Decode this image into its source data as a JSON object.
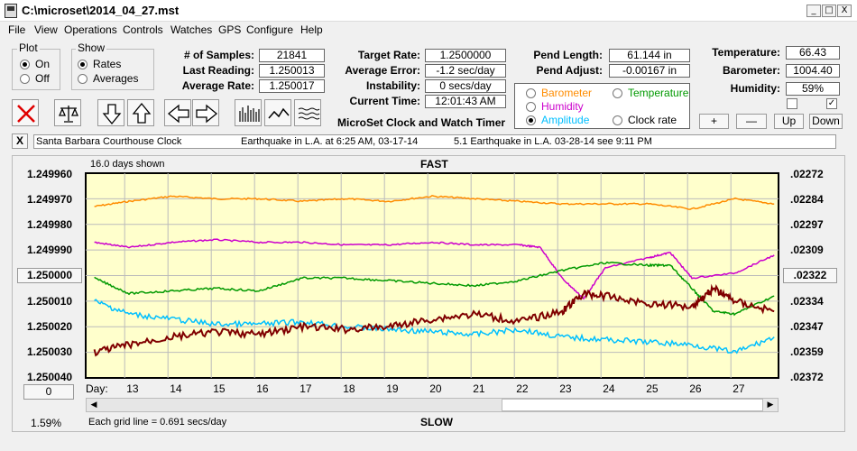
{
  "window": {
    "title": "C:\\microset\\2014_04_27.mst"
  },
  "window_controls": {
    "minimize": "_",
    "maximize": "□",
    "close": "X"
  },
  "menu": [
    "File",
    "View",
    "Operations",
    "Controls",
    "Watches",
    "GPS",
    "Configure",
    "Help"
  ],
  "plot_group": {
    "label": "Plot",
    "options": [
      "On",
      "Off"
    ],
    "selected": "On"
  },
  "show_group": {
    "label": "Show",
    "options": [
      "Rates",
      "Averages"
    ],
    "selected": "Rates"
  },
  "stats": {
    "samples_label": "# of Samples:",
    "samples": "21841",
    "last_reading_label": "Last Reading:",
    "last_reading": "1.250013",
    "average_rate_label": "Average Rate:",
    "average_rate": "1.250017",
    "target_rate_label": "Target Rate:",
    "target_rate": "1.2500000",
    "average_error_label": "Average Error:",
    "average_error": "-1.2 sec/day",
    "instability_label": "Instability:",
    "instability": "0 secs/day",
    "current_time_label": "Current Time:",
    "current_time": "12:01:43 AM",
    "pend_length_label": "Pend Length:",
    "pend_length": "61.144 in",
    "pend_adjust_label": "Pend Adjust:",
    "pend_adjust": "-0.00167 in",
    "temperature_label": "Temperature:",
    "temperature": "66.43",
    "barometer_label": "Barometer:",
    "barometer": "1004.40",
    "humidity_label": "Humidity:",
    "humidity": "59%"
  },
  "app_title": "MicroSet Clock and Watch Timer",
  "series_selector": {
    "items": [
      {
        "label": "Barometer",
        "color": "#ff8c00",
        "selected": false
      },
      {
        "label": "Temperature",
        "color": "#009900",
        "selected": false
      },
      {
        "label": "Humidity",
        "color": "#cc00cc",
        "selected": false
      },
      {
        "label": "Amplitude",
        "color": "#00bfff",
        "selected": true
      },
      {
        "label": "Clock rate",
        "color": "#000000",
        "selected": false
      }
    ]
  },
  "adjust_buttons": {
    "plus": "+",
    "minus": "—",
    "up": "Up",
    "down": "Down"
  },
  "checkboxes": [
    false,
    true
  ],
  "notes": {
    "close": "X",
    "clock_name": "Santa Barbara Courthouse Clock",
    "note1": "Earthquake in L.A. at 6:25 AM, 03-17-14",
    "note2": "5.1 Earthquake in L.A. 03-28-14  see 9:11 PM"
  },
  "chart_data": {
    "type": "line",
    "title": "FAST",
    "bottom_title": "SLOW",
    "days_shown": "16.0 days shown",
    "grid_note": "Each grid line = 0.691 secs/day",
    "left_percent": "1.59%",
    "x_prefix": "Day:",
    "x_ticks": [
      "13",
      "14",
      "15",
      "16",
      "17",
      "18",
      "19",
      "20",
      "21",
      "22",
      "23",
      "24",
      "25",
      "26",
      "27"
    ],
    "y_left_ticks": [
      "1.249960",
      "1.249970",
      "1.249980",
      "1.249990",
      "1.250000",
      "1.250010",
      "1.250020",
      "1.250030",
      "1.250040"
    ],
    "y_right_ticks": [
      ".02272",
      ".02284",
      ".02297",
      ".02309",
      ".02322",
      ".02334",
      ".02347",
      ".02359",
      ".02372"
    ],
    "y_center_button": "1.250000",
    "y_right_center_button": ".02322",
    "bottom_left_button": "0",
    "ylim_rate": [
      1.24996,
      1.25004
    ],
    "grid": true,
    "series": [
      {
        "name": "Barometer",
        "color": "#ff8c00",
        "x": [
          12.2,
          13,
          14,
          15,
          16,
          17,
          18,
          19,
          20,
          21,
          22,
          23,
          24,
          25,
          26,
          27,
          27.9
        ],
        "y": [
          1.249973,
          1.249971,
          1.249969,
          1.24997,
          1.24997,
          1.249971,
          1.24997,
          1.249971,
          1.249969,
          1.24997,
          1.249971,
          1.249972,
          1.249972,
          1.249972,
          1.249974,
          1.24997,
          1.249972
        ]
      },
      {
        "name": "Humidity",
        "color": "#cc00cc",
        "x": [
          12.2,
          13,
          14,
          15,
          16,
          17,
          18,
          19,
          20,
          21,
          22,
          22.5,
          23,
          23.5,
          24,
          25,
          25.5,
          26,
          27,
          27.9
        ],
        "y": [
          1.249987,
          1.249989,
          1.249987,
          1.249986,
          1.249987,
          1.249987,
          1.249988,
          1.249988,
          1.249987,
          1.249988,
          1.249988,
          1.249989,
          1.250001,
          1.250009,
          1.249997,
          1.249993,
          1.249991,
          1.250001,
          1.249999,
          1.249992
        ]
      },
      {
        "name": "Temperature",
        "color": "#009900",
        "x": [
          12.2,
          13,
          14,
          15,
          16,
          17,
          18,
          19,
          20,
          21,
          22,
          23,
          24,
          25,
          25.5,
          26,
          26.5,
          27,
          27.9
        ],
        "y": [
          1.250001,
          1.250007,
          1.250006,
          1.250005,
          1.250006,
          1.250001,
          1.250001,
          1.250002,
          1.250003,
          1.250004,
          1.250002,
          1.249998,
          1.249995,
          1.249996,
          1.249996,
          1.250005,
          1.250014,
          1.250015,
          1.250008
        ]
      },
      {
        "name": "Amplitude",
        "color": "#00bfff",
        "x": [
          12.2,
          13,
          14,
          15,
          16,
          17,
          18,
          19,
          20,
          21,
          22,
          23,
          24,
          25,
          26,
          27,
          27.9
        ],
        "y": [
          1.25001,
          1.250015,
          1.250017,
          1.250019,
          1.250019,
          1.250018,
          1.25002,
          1.250021,
          1.250022,
          1.250023,
          1.250021,
          1.250024,
          1.250025,
          1.250026,
          1.250027,
          1.25003,
          1.250024
        ]
      },
      {
        "name": "Clock rate",
        "color": "#800000",
        "x": [
          12.2,
          13,
          14,
          15,
          16,
          17,
          18,
          19,
          20,
          21,
          22,
          23,
          23.5,
          24,
          25,
          26,
          26.5,
          27,
          27.9
        ],
        "y": [
          1.25003,
          1.250027,
          1.250024,
          1.250022,
          1.250023,
          1.25002,
          1.250021,
          1.25002,
          1.250017,
          1.250015,
          1.250018,
          1.250014,
          1.250007,
          1.250008,
          1.250011,
          1.250012,
          1.250005,
          1.25001,
          1.250014
        ]
      }
    ]
  }
}
